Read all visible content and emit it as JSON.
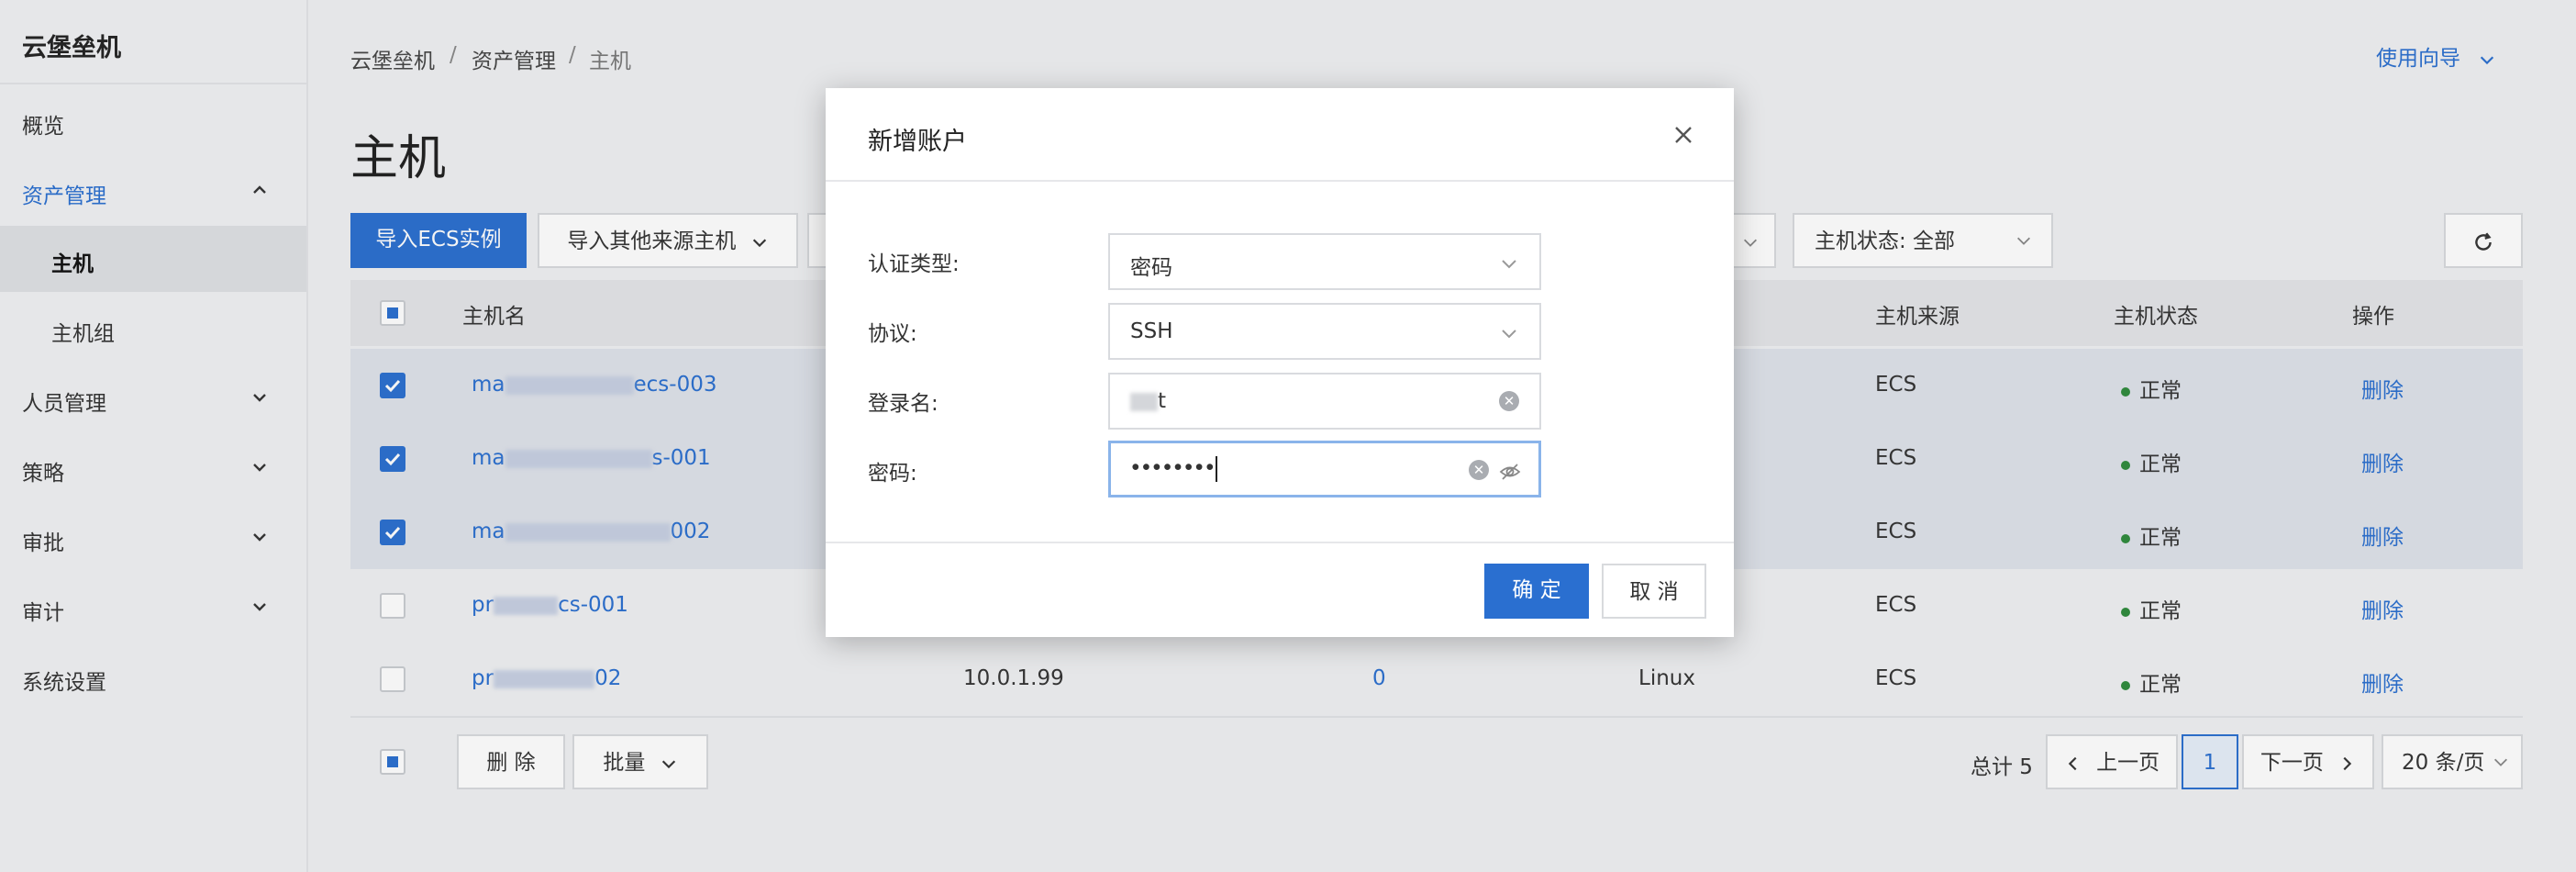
{
  "sidebar": {
    "brand": "云堡垒机",
    "items": [
      {
        "label": "概览"
      },
      {
        "label": "资产管理"
      },
      {
        "label": "主机"
      },
      {
        "label": "主机组"
      },
      {
        "label": "人员管理"
      },
      {
        "label": "策略"
      },
      {
        "label": "审批"
      },
      {
        "label": "审计"
      },
      {
        "label": "系统设置"
      }
    ]
  },
  "breadcrumb": [
    "云堡垒机",
    "资产管理",
    "主机"
  ],
  "breadcrumb_sep": "/",
  "guide_label": "使用向导",
  "page_title": "主机",
  "toolbar": {
    "import_ecs": "导入ECS实例",
    "import_other": "导入其他来源主机",
    "status_filter": "主机状态: 全部"
  },
  "table": {
    "columns": [
      "主机名",
      "主机来源",
      "主机状态",
      "操作"
    ],
    "rows": [
      {
        "name_start": "ma",
        "name_end": "ecs-003",
        "ip": "",
        "count": "",
        "os": "",
        "source": "ECS",
        "status": "正常",
        "action": "删除",
        "checked": true
      },
      {
        "name_start": "ma",
        "name_end": "s-001",
        "ip": "",
        "count": "",
        "os": "",
        "source": "ECS",
        "status": "正常",
        "action": "删除",
        "checked": true
      },
      {
        "name_start": "ma",
        "name_end": "002",
        "ip": "",
        "count": "",
        "os": "",
        "source": "ECS",
        "status": "正常",
        "action": "删除",
        "checked": true
      },
      {
        "name_start": "pr",
        "name_end": "cs-001",
        "ip": "",
        "count": "",
        "os": "",
        "source": "ECS",
        "status": "正常",
        "action": "删除",
        "checked": false
      },
      {
        "name_start": "pr",
        "name_end": "02",
        "ip": "10.0.1.99",
        "count": "0",
        "os": "Linux",
        "source": "ECS",
        "status": "正常",
        "action": "删除",
        "checked": false
      }
    ]
  },
  "footer": {
    "delete_label": "删 除",
    "batch_label": "批量",
    "total": "总计 5",
    "prev": "上一页",
    "page": "1",
    "next": "下一页",
    "page_size": "20 条/页"
  },
  "modal": {
    "title": "新增账户",
    "auth_type_label": "认证类型:",
    "auth_type_value": "密码",
    "protocol_label": "协议:",
    "protocol_value": "SSH",
    "login_label": "登录名:",
    "login_value_end": "t",
    "password_label": "密码:",
    "password_value": "••••••••",
    "confirm_label": "确 定",
    "cancel_label": "取 消"
  },
  "colors": {
    "accent": "#2a6fd0",
    "status_ok": "#2e8b3c"
  }
}
